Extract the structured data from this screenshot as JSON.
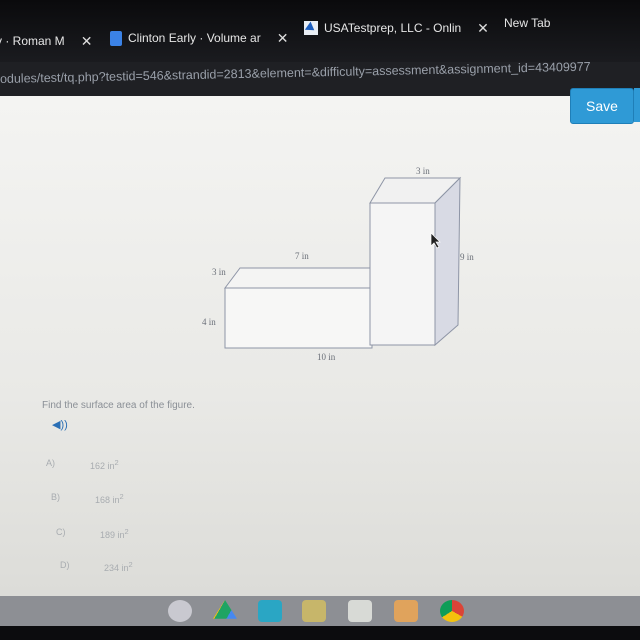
{
  "browser": {
    "tabs": [
      {
        "label": "y · Roman M",
        "icon": "close-icon"
      },
      {
        "label": "Clinton Early · Volume ar",
        "icon": "google-docs-icon"
      },
      {
        "label": "USATestprep, LLC - Onlin",
        "icon": "usatestprep-icon"
      },
      {
        "label": "New Tab"
      }
    ],
    "url": "odules/test/tq.php?testid=546&strandid=2813&element=&difficulty=assessment&assignment_id=43409977"
  },
  "toolbar": {
    "save_label": "Save",
    "save_color": "#2f9ad6"
  },
  "figure": {
    "labels": {
      "top_width": "3 in",
      "tall_height": "9 in",
      "small_length": "7 in",
      "small_depth": "3 in",
      "small_height": "4 in",
      "base_length": "10 in"
    }
  },
  "question": {
    "prompt": "Find the surface area of the figure.",
    "audio_icon": "speaker-icon",
    "options": [
      {
        "letter": "A)",
        "value": "162 in",
        "sup": "2"
      },
      {
        "letter": "B)",
        "value": "168 in",
        "sup": "2"
      },
      {
        "letter": "C)",
        "value": "189 in",
        "sup": "2"
      },
      {
        "letter": "D)",
        "value": "234 in",
        "sup": "2"
      }
    ]
  },
  "shelf": {
    "apps": [
      "camera-icon",
      "google-drive-icon",
      "screencastify-icon",
      "google-classroom-icon",
      "app-icon",
      "its-learning-icon",
      "chrome-icon"
    ]
  }
}
